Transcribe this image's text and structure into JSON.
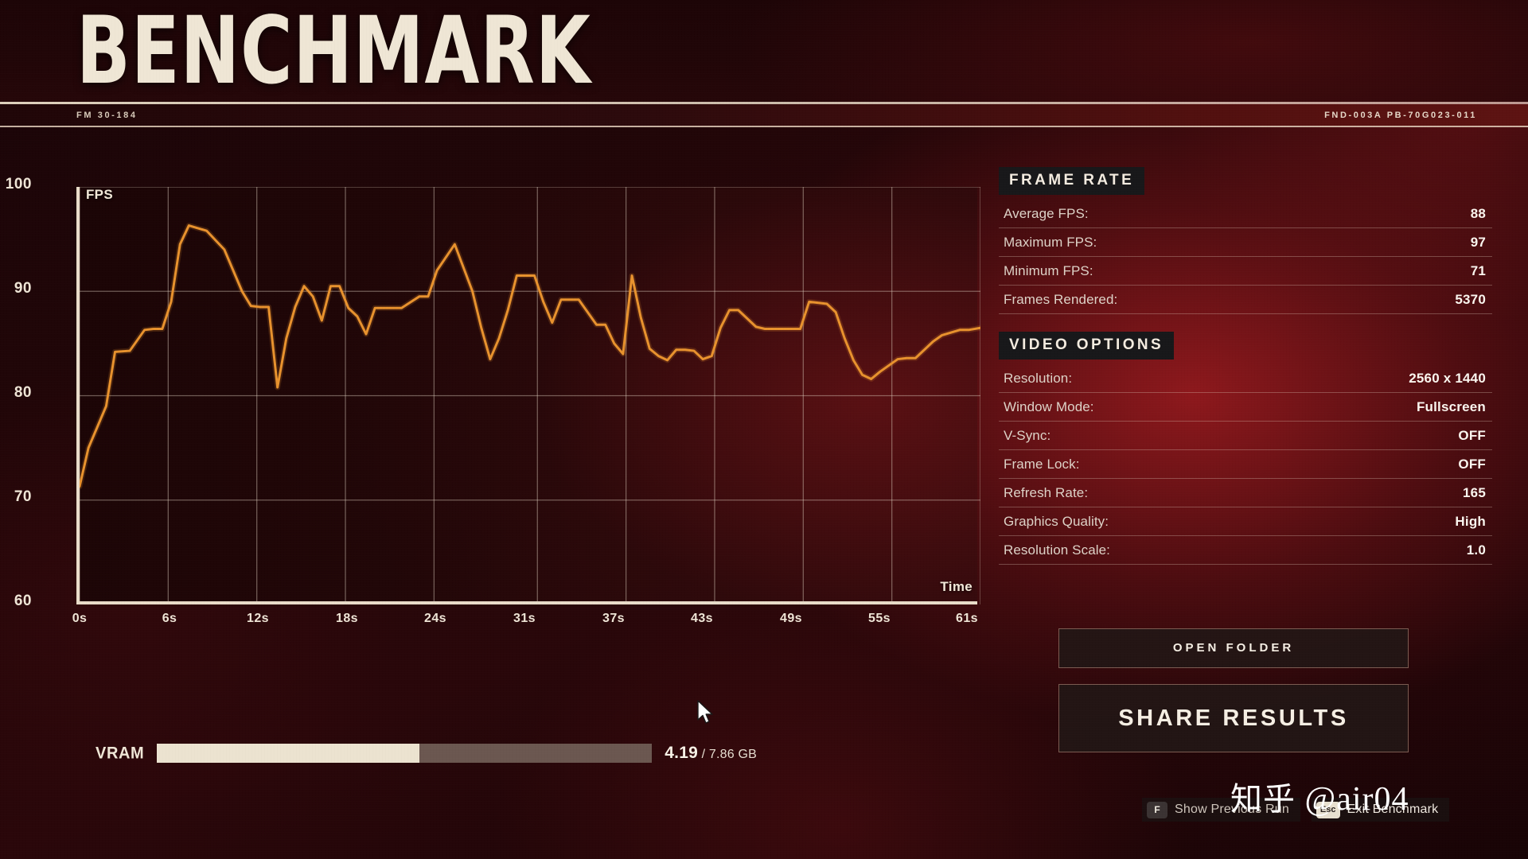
{
  "header": {
    "title": "BENCHMARK",
    "code_left": "FM 30-184",
    "code_right": "FND-003A PB-70G023-011"
  },
  "chart_axis": {
    "y_label": "FPS",
    "x_label": "Time",
    "y_ticks": [
      "100",
      "90",
      "80",
      "70",
      "60"
    ],
    "x_ticks": [
      "0s",
      "6s",
      "12s",
      "18s",
      "24s",
      "31s",
      "37s",
      "43s",
      "49s",
      "55s",
      "61s"
    ]
  },
  "chart_data": {
    "type": "line",
    "title": "",
    "xlabel": "Time",
    "ylabel": "FPS",
    "xlim": [
      0,
      61
    ],
    "ylim": [
      60,
      100
    ],
    "grid": true,
    "legend": "none",
    "line_color": "#e8922e",
    "x": [
      0.0,
      0.6,
      1.8,
      2.4,
      3.4,
      4.4,
      5.0,
      5.6,
      6.2,
      6.8,
      7.4,
      8.6,
      9.8,
      10.4,
      11.0,
      11.6,
      12.2,
      12.8,
      13.4,
      14.0,
      14.6,
      15.2,
      15.8,
      16.4,
      17.0,
      17.6,
      18.2,
      18.8,
      19.4,
      20.0,
      20.6,
      21.8,
      23.0,
      23.6,
      24.2,
      25.4,
      26.6,
      27.2,
      27.8,
      28.4,
      29.0,
      29.6,
      30.8,
      31.4,
      32.0,
      32.6,
      33.2,
      33.8,
      34.4,
      35.0,
      35.6,
      36.2,
      36.8,
      37.4,
      38.0,
      38.6,
      39.2,
      39.8,
      40.4,
      41.0,
      41.6,
      42.2,
      42.8,
      43.4,
      44.0,
      44.6,
      45.8,
      46.4,
      47.0,
      47.6,
      48.8,
      49.4,
      50.6,
      51.2,
      51.8,
      52.4,
      53.0,
      53.6,
      54.2,
      55.4,
      56.0,
      56.6,
      57.8,
      58.4,
      59.6,
      60.2,
      61.0
    ],
    "y": [
      71.3,
      75.0,
      79.0,
      84.2,
      84.3,
      86.3,
      86.4,
      86.4,
      89.0,
      94.5,
      96.3,
      95.8,
      94.0,
      92.0,
      90.0,
      88.6,
      88.5,
      88.5,
      80.8,
      85.5,
      88.5,
      90.5,
      89.5,
      87.2,
      90.5,
      90.5,
      88.4,
      87.6,
      85.9,
      88.4,
      88.4,
      88.4,
      89.5,
      89.5,
      92.0,
      94.5,
      90.0,
      86.5,
      83.5,
      85.5,
      88.2,
      91.5,
      91.5,
      89.0,
      87.0,
      89.2,
      89.2,
      89.2,
      88.0,
      86.8,
      86.8,
      85.0,
      84.0,
      91.5,
      87.5,
      84.5,
      83.8,
      83.4,
      84.4,
      84.4,
      84.3,
      83.5,
      83.8,
      86.5,
      88.2,
      88.2,
      86.6,
      86.4,
      86.4,
      86.4,
      86.4,
      89.0,
      88.8,
      88.0,
      85.5,
      83.4,
      82.0,
      81.6,
      82.3,
      83.5,
      83.6,
      83.6,
      85.2,
      85.8,
      86.3,
      86.3,
      86.5
    ]
  },
  "frame_rate": {
    "heading": "FRAME RATE",
    "rows": [
      {
        "label": "Average FPS:",
        "value": "88"
      },
      {
        "label": "Maximum FPS:",
        "value": "97"
      },
      {
        "label": "Minimum FPS:",
        "value": "71"
      },
      {
        "label": "Frames Rendered:",
        "value": "5370"
      }
    ]
  },
  "video_options": {
    "heading": "VIDEO OPTIONS",
    "rows": [
      {
        "label": "Resolution:",
        "value": "2560 x 1440"
      },
      {
        "label": "Window Mode:",
        "value": "Fullscreen"
      },
      {
        "label": "V-Sync:",
        "value": "OFF"
      },
      {
        "label": "Frame Lock:",
        "value": "OFF"
      },
      {
        "label": "Refresh Rate:",
        "value": "165"
      },
      {
        "label": "Graphics Quality:",
        "value": "High"
      },
      {
        "label": "Resolution Scale:",
        "value": "1.0"
      }
    ]
  },
  "buttons": {
    "open_folder": "OPEN FOLDER",
    "share_results": "SHARE RESULTS"
  },
  "vram": {
    "label": "VRAM",
    "used": "4.19",
    "separator": " / ",
    "total": "7.86 GB",
    "fill_percent": 53
  },
  "hints": [
    {
      "key": "F",
      "text": "Show Previous Run"
    },
    {
      "key": "Esc",
      "text": "Exit Benchmark"
    }
  ],
  "watermark": {
    "site": "知乎",
    "user": "@air04"
  },
  "colors": {
    "accent_line": "#e8922e",
    "cream": "#efe6d5",
    "panel_header_bg": "#18181a",
    "backdrop_red": "#8c1a1e"
  }
}
